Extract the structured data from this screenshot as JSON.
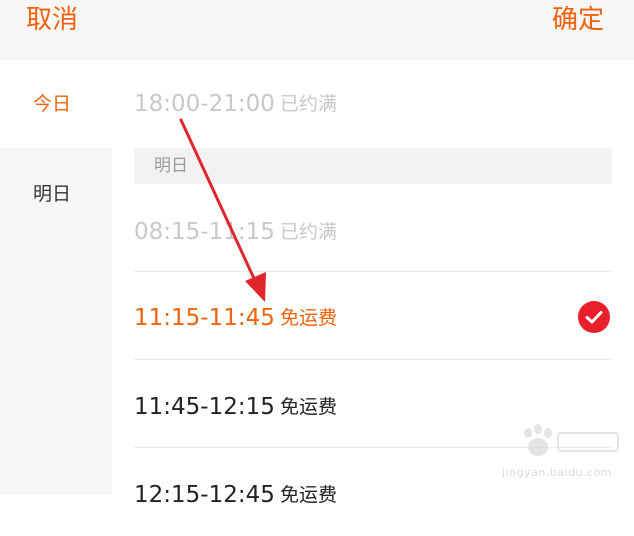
{
  "header": {
    "cancel_label": "取消",
    "confirm_label": "确定"
  },
  "sidebar": {
    "items": [
      {
        "label": "今日"
      },
      {
        "label": "明日"
      }
    ]
  },
  "today": {
    "slots": [
      {
        "time": "18:00-21:00",
        "status": "已约满"
      }
    ]
  },
  "tomorrow": {
    "label": "明日",
    "slots": [
      {
        "time": "08:15-11:15",
        "status": "已约满"
      },
      {
        "time": "11:15-11:45",
        "status": "免运费"
      },
      {
        "time": "11:45-12:15",
        "status": "免运费"
      },
      {
        "time": "12:15-12:45",
        "status": "免运费"
      }
    ]
  },
  "colors": {
    "accent": "#f0620a",
    "disabled": "#c8c8c8",
    "selected_check": "#e8202c",
    "annotation_arrow": "#e0252b"
  },
  "icons": {
    "selected": "check-circle-icon",
    "annotation": "red-arrow-icon",
    "watermark": "baidu-jingyan-logo-icon"
  },
  "watermark": {
    "text": "jingyan.baidu.com"
  }
}
